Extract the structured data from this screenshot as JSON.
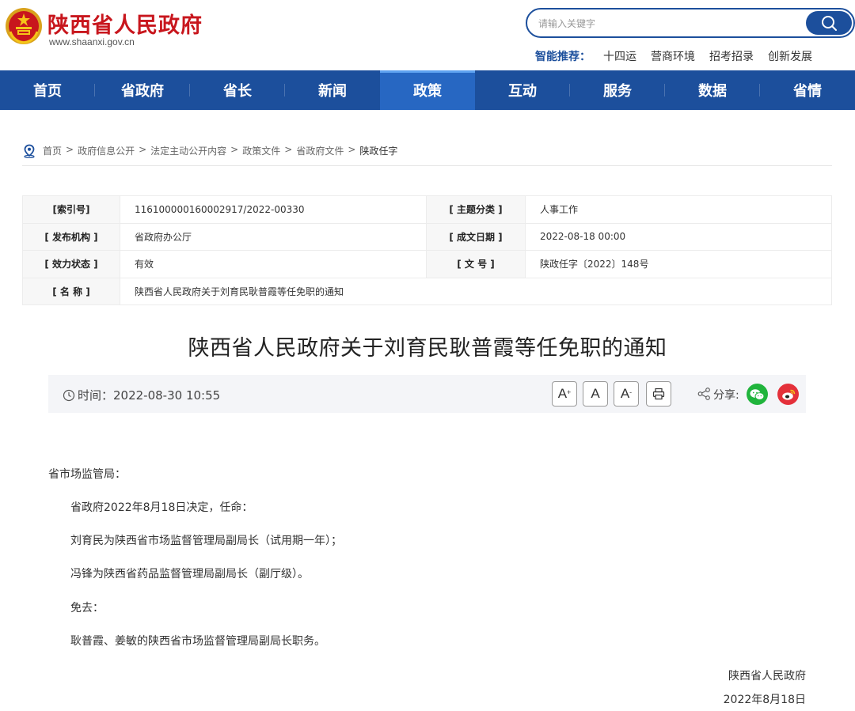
{
  "header": {
    "site_title": "陕西省人民政府",
    "site_url": "www.shaanxi.gov.cn",
    "search": {
      "placeholder": "请输入关键字"
    },
    "recommend_label": "智能推荐：",
    "recommend_links": [
      "十四运",
      "营商环境",
      "招考招录",
      "创新发展"
    ]
  },
  "nav": {
    "items": [
      "首页",
      "省政府",
      "省长",
      "新闻",
      "政策",
      "互动",
      "服务",
      "数据",
      "省情"
    ],
    "active": "政策"
  },
  "breadcrumb": [
    "首页",
    "政府信息公开",
    "法定主动公开内容",
    "政策文件",
    "省政府文件",
    "陕政任字"
  ],
  "breadcrumb_separator": ">",
  "meta": {
    "index_label": "[索引号]",
    "index_value": "116100000160002917/2022-00330",
    "topic_label": "[ 主题分类 ]",
    "topic_value": "人事工作",
    "issuer_label": "[ 发布机构 ]",
    "issuer_value": "省政府办公厅",
    "date_label": "[ 成文日期 ]",
    "date_value": "2022-08-18 00:00",
    "status_label": "[ 效力状态 ]",
    "status_value": "有效",
    "docno_label": "[ 文 号 ]",
    "docno_value": "陕政任字〔2022〕148号",
    "name_label": "[ 名 称 ]",
    "name_value": "陕西省人民政府关于刘育民耿普霞等任免职的通知"
  },
  "article": {
    "title": "陕西省人民政府关于刘育民耿普霞等任免职的通知",
    "time": "时间：2022-08-30 10:55",
    "font_larger": "A",
    "font_normal": "A",
    "font_smaller": "A",
    "share_label": "分享:",
    "paragraphs": [
      "省市场监管局：",
      "省政府2022年8月18日决定，任命：",
      "刘育民为陕西省市场监督管理局副局长（试用期一年）；",
      "冯锋为陕西省药品监督管理局副局长（副厅级）。",
      "免去：",
      "耿普霞、姜敏的陕西省市场监督管理局副局长职务。"
    ],
    "signature": "陕西省人民政府",
    "sign_date": "2022年8月18日"
  },
  "colors": {
    "brand_red": "#c8161d",
    "nav_blue": "#1c4f9c",
    "nav_active": "#2767c2",
    "wechat_green": "#20b43c",
    "weibo_red": "#e4303a"
  }
}
